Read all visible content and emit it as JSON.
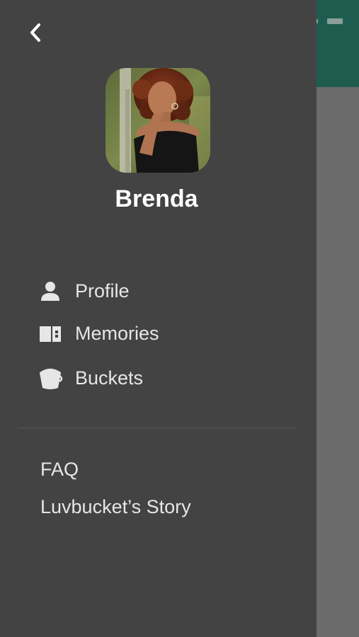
{
  "user": {
    "name": "Brenda"
  },
  "menu": {
    "items": [
      {
        "label": "Profile",
        "icon": "person-icon"
      },
      {
        "label": "Memories",
        "icon": "memories-icon"
      },
      {
        "label": "Buckets",
        "icon": "bucket-icon"
      }
    ]
  },
  "links": [
    {
      "label": "FAQ"
    },
    {
      "label": "Luvbucket’s Story"
    }
  ],
  "colors": {
    "drawer_bg": "#434343",
    "overlay_bg": "#6b6b6b",
    "header_bg": "#1f5c50",
    "text_primary": "#ffffff",
    "text_secondary": "#e6e6e6"
  }
}
